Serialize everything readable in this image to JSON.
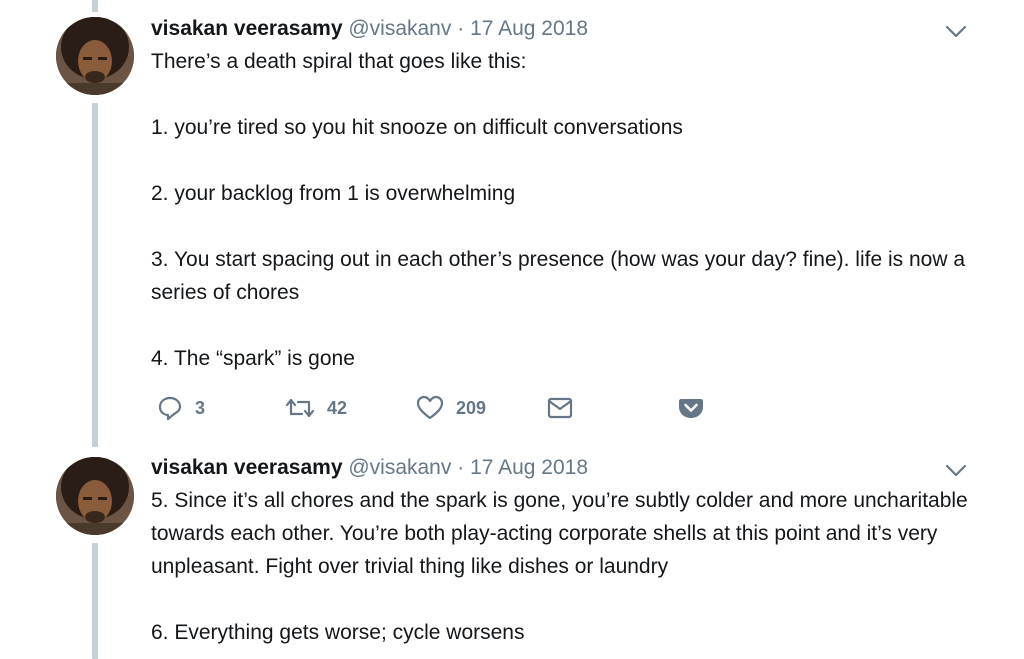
{
  "colors": {
    "text": "#14171a",
    "muted": "#657786",
    "thread": "#c4cfd6",
    "icon": "#657786"
  },
  "tweets": [
    {
      "name": "visakan veerasamy",
      "handle": "@visakanv",
      "separator": "·",
      "date": "17 Aug 2018",
      "lines": [
        "There’s a death spiral that goes like this:",
        "",
        "1. you’re tired so you hit snooze on difficult conversations",
        "",
        "2. your backlog from 1 is overwhelming",
        "",
        "3. You start spacing out in each other’s presence (how was your day? fine). life is now a series of chores",
        "",
        "4. The “spark” is gone"
      ],
      "actions": {
        "reply_count": "3",
        "retweet_count": "42",
        "like_count": "209"
      }
    },
    {
      "name": "visakan veerasamy",
      "handle": "@visakanv",
      "separator": "·",
      "date": "17 Aug 2018",
      "lines": [
        "5. Since it’s all chores and the spark is gone, you’re subtly colder and more uncharitable towards each other. You’re both play-acting corporate shells at this point and it’s very unpleasant. Fight over trivial thing like dishes or laundry",
        "",
        "6. Everything gets worse; cycle worsens"
      ]
    }
  ]
}
